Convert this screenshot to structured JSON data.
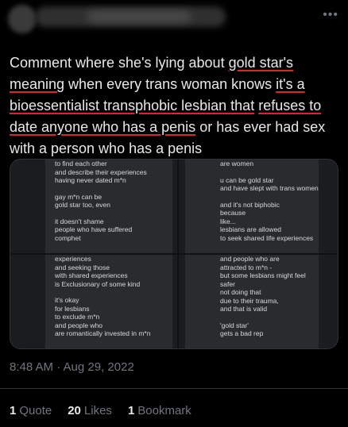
{
  "tweet": {
    "more_icon": "more-horizontal-icon",
    "text_parts": [
      "Comment where she's lying about ",
      "gold star's",
      " ",
      "meaning",
      " when every trans woman knows ",
      "it's a",
      " ",
      "bioessentialist transphobic lesbian that",
      " ",
      "refuses to",
      " ",
      "date anyone who has a penis",
      " or has ever had sex with a person who has a penis"
    ],
    "timestamp": "8:48 AM · Aug 29, 2022"
  },
  "media": {
    "panel1": [
      "to find each other",
      "and describe their experiences",
      "having never dated m*n",
      "",
      "gay m*n can be",
      "gold star too, even",
      "",
      "it doesn't shame",
      "people who have suffered",
      "comphet"
    ],
    "panel2": [
      "are women",
      "",
      "u can be gold star",
      "and have slept with trans women",
      "",
      "and it's not biphobic",
      "because",
      "like...",
      "lesbians are allowed",
      "to seek shared life experiences"
    ],
    "panel3": [
      "experiences",
      "and seeking those",
      "with shared experiences",
      "is Exclusionary of some kind",
      "",
      "it's okay",
      "for lesbians",
      "to exclude m*n",
      "and people who",
      "are romantically invested in m*n"
    ],
    "panel4": [
      "and people who are",
      "attracted to m*n -",
      "but some lesbians might feel",
      "safer",
      "not doing that",
      "due to their trauma,",
      "and that is valid",
      "",
      "'gold star'",
      "gets a bad rep"
    ]
  },
  "stats": {
    "quotes_count": "1",
    "quotes_label": "Quote",
    "likes_count": "20",
    "likes_label": "Likes",
    "bookmarks_count": "1",
    "bookmarks_label": "Bookmark"
  }
}
